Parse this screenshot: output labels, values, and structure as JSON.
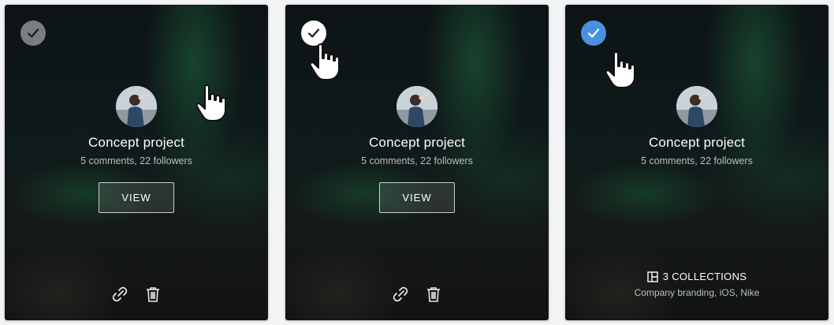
{
  "cards": [
    {
      "state": "default",
      "checkbox_icon": "check-icon",
      "title": "Concept project",
      "subtitle": "5 comments, 22 followers",
      "view_label": "VIEW",
      "actions": [
        "link-icon",
        "trash-icon"
      ]
    },
    {
      "state": "hover",
      "checkbox_icon": "check-icon",
      "title": "Concept project",
      "subtitle": "5 comments, 22 followers",
      "view_label": "VIEW",
      "actions": [
        "link-icon",
        "trash-icon"
      ]
    },
    {
      "state": "selected",
      "checkbox_icon": "check-icon",
      "title": "Concept project",
      "subtitle": "5 comments, 22 followers",
      "collections_label": "3 COLLECTIONS",
      "collections_list": "Company branding, iOS, Nike",
      "collections_icon": "collections-icon"
    }
  ],
  "colors": {
    "selected_accent": "#4a90e2",
    "default_check": "#7a7e80",
    "hover_check": "#ffffff"
  }
}
